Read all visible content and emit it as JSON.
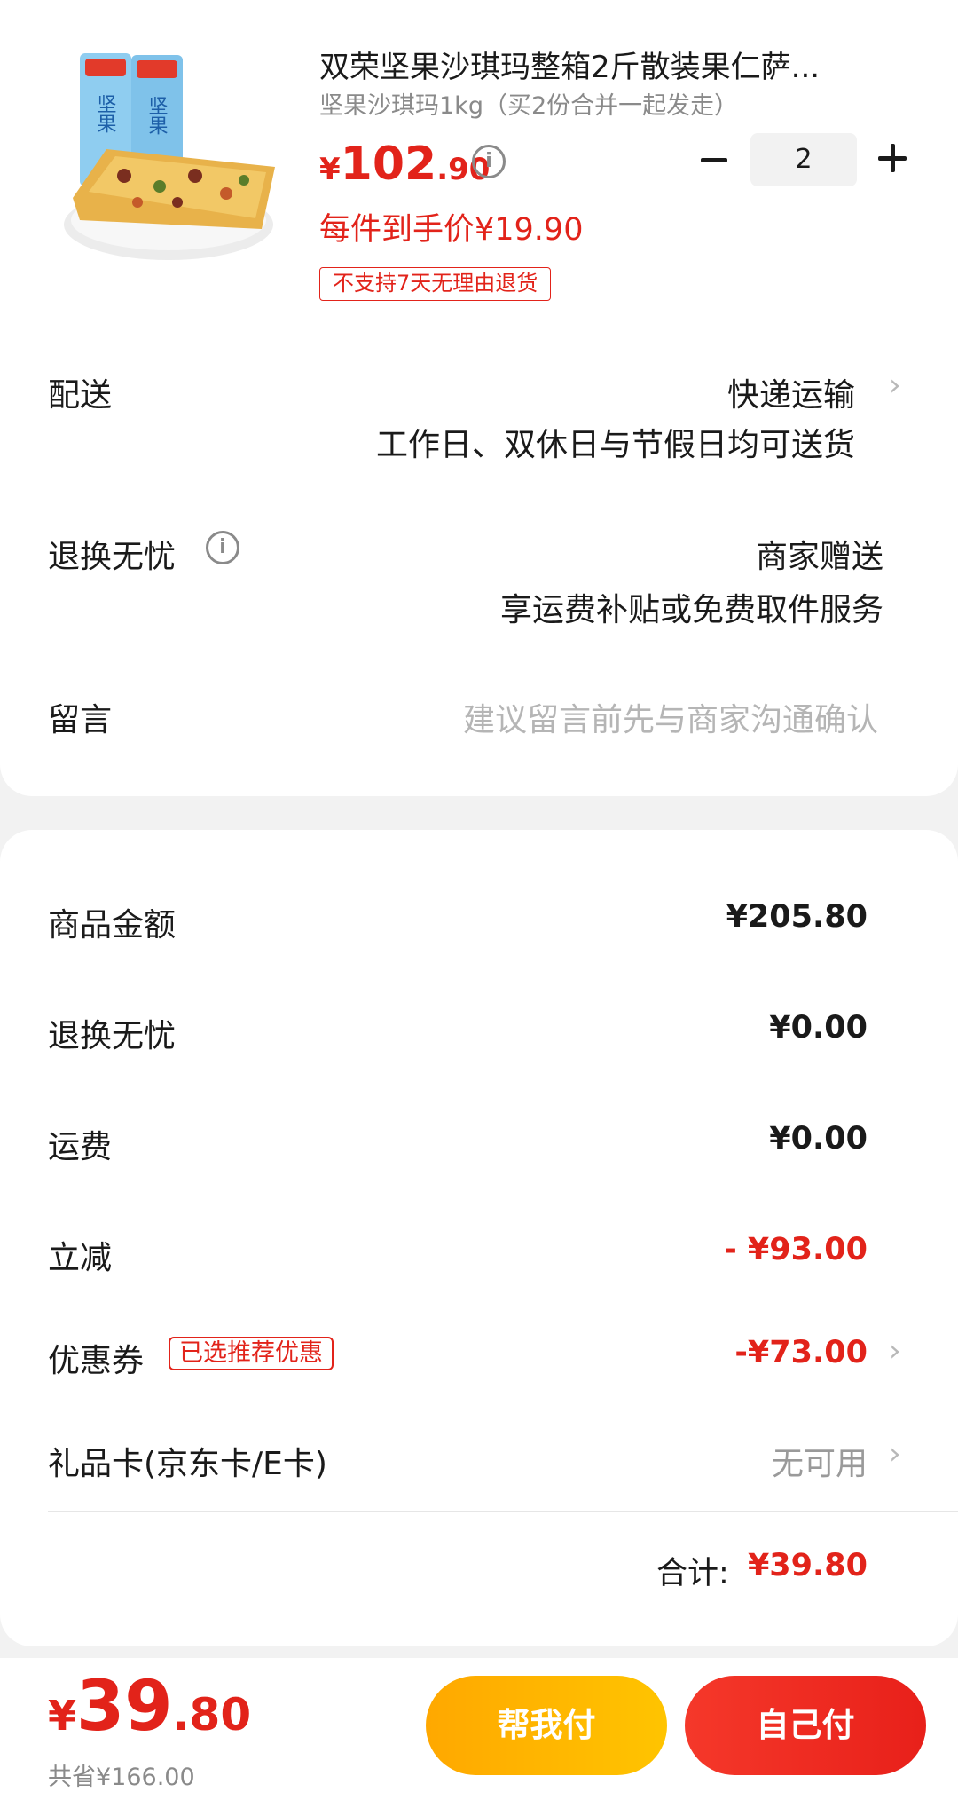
{
  "product": {
    "title": "双荣坚果沙琪玛整箱2斤散装果仁萨...",
    "spec": "坚果沙琪玛1kg（买2份合并一起发走）",
    "price_currency": "¥",
    "price_int": "102",
    "price_dec": ".90",
    "info_icon": "i",
    "unit_price": "每件到手价¥19.90",
    "return_tag": "不支持7天无理由退货",
    "quantity": "2",
    "image_packages": [
      "坚果",
      "坚果"
    ]
  },
  "delivery": {
    "label": "配送",
    "method": "快递运输",
    "note": "工作日、双休日与节假日均可送货"
  },
  "return_service": {
    "label": "退换无忧",
    "info_icon": "i",
    "provider": "商家赠送",
    "desc": "享运费补贴或免费取件服务"
  },
  "message": {
    "label": "留言",
    "placeholder": "建议留言前先与商家沟通确认"
  },
  "summary": {
    "goods_label": "商品金额",
    "goods_value": "¥205.80",
    "return_label": "退换无忧",
    "return_value": "¥0.00",
    "shipping_label": "运费",
    "shipping_value": "¥0.00",
    "discount_label": "立减",
    "discount_value": "- ¥93.00",
    "coupon_label": "优惠券",
    "coupon_tag": "已选推荐优惠",
    "coupon_value": "-¥73.00",
    "giftcard_label": "礼品卡(京东卡/E卡)",
    "giftcard_value": "无可用",
    "total_label": "合计:",
    "total_value": "¥39.80"
  },
  "bottom": {
    "currency": "¥",
    "price_int": "39",
    "price_dec": ".80",
    "saved": "共省¥166.00",
    "help_pay": "帮我付",
    "self_pay": "自己付"
  },
  "icons": {
    "chevron": "›",
    "minus": "minus-icon",
    "plus": "plus-icon"
  },
  "colors": {
    "accent_red": "#e2231a",
    "help_button": "#ffb400",
    "self_button": "#f0281f"
  }
}
